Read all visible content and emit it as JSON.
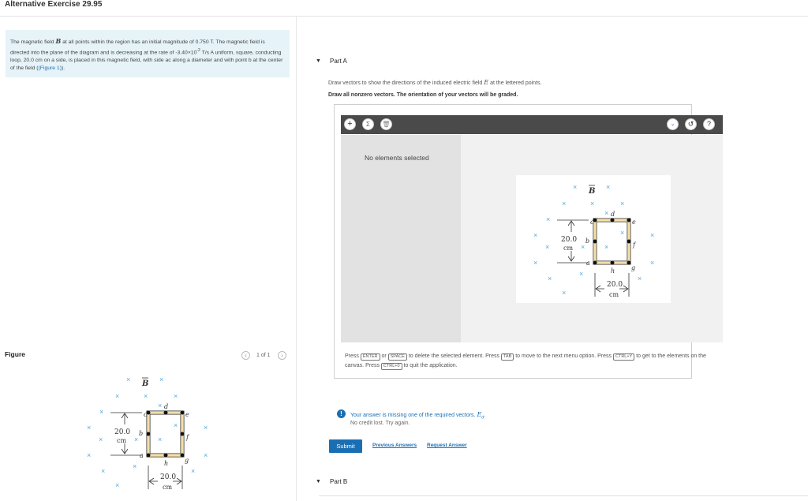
{
  "header": {
    "title": "Alternative Exercise 29.95"
  },
  "problem": {
    "text_1": "The magnetic field",
    "b_symbol": "B",
    "text_2": "at all points within the region has an initial magnitude of 0.750 T. The magnetic field is directed into the plane of the diagram and is decreasing at the rate of -3.40×10",
    "exponent": "-2",
    "text_3": " T/s A uniform, square, conducting loop, 20.0 cm on a side, is placed in this magnetic field, with side ac along a diameter and with point b at the center of the field (",
    "figure_link": "(Figure 1)",
    "text_4": ")."
  },
  "figure_panel": {
    "label": "Figure",
    "pager_text": "1 of 1",
    "prev_icon": "chevron-left-icon",
    "next_icon": "chevron-right-icon"
  },
  "figure": {
    "b_label": "B",
    "dim_left_value": "20.0",
    "dim_left_unit": "cm",
    "dim_bottom_value": "20.0",
    "dim_bottom_unit": "cm",
    "points": {
      "a": "a",
      "b": "b",
      "c": "c",
      "d": "d",
      "e": "e",
      "f": "f",
      "g": "g",
      "h": "h"
    },
    "x_mark": "×",
    "loop_color": "#f5dfa8"
  },
  "partA": {
    "caret_icon": "caret-down-icon",
    "label": "Part A",
    "instruction_1a": "Draw vectors to show the directions of the induced electric field",
    "e_symbol": "E",
    "instruction_1b": "at the lettered points.",
    "instruction_2": "Draw all nonzero vectors. The orientation of your vectors will be graded.",
    "tool": {
      "add_icon": "plus-icon",
      "add_glyph": "+",
      "sigma_icon": "sigma-icon",
      "sigma_glyph": "Σ",
      "trash_icon": "trash-icon",
      "trash_glyph": "🗑",
      "dropdown_icon": "chevron-down-icon",
      "dropdown_glyph": "⌄",
      "reset_icon": "reset-icon",
      "reset_glyph": "↺",
      "help_icon": "help-icon",
      "help_glyph": "?",
      "no_selection": "No elements selected"
    },
    "help_text": {
      "p1": "Press",
      "key_enter": "ENTER",
      "p2": "or",
      "key_space": "SPACE",
      "p3": "to delete the selected element. Press",
      "key_tab": "TAB",
      "p4": "to move to the next menu option. Press",
      "key_ctrl_y": "CTRL+Y",
      "p5": "to get to the elements on the canvas. Press",
      "key_ctrl_0": "CTRL+0",
      "p6": "to quit the application."
    },
    "warning": {
      "icon": "alert-icon",
      "glyph": "!",
      "message": "Your answer is missing one of the required vectors.",
      "e_symbol": "E",
      "e_sub": "d",
      "period": ".",
      "sub": "No credit lost. Try again."
    },
    "submit": "Submit",
    "previous_answers": "Previous Answers",
    "request_answer": "Request Answer"
  },
  "partB": {
    "caret_icon": "caret-down-icon",
    "label": "Part B"
  }
}
